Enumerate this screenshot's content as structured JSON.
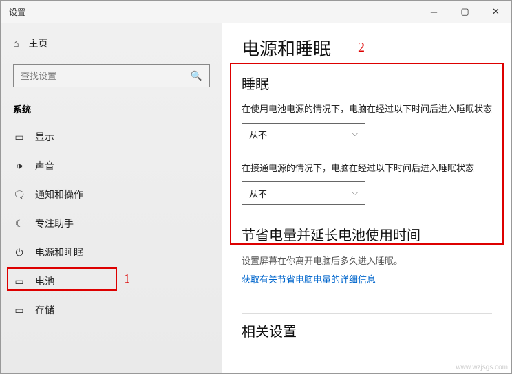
{
  "window": {
    "title": "设置"
  },
  "sidebar": {
    "home": "主页",
    "search_placeholder": "查找设置",
    "section": "系统",
    "items": [
      {
        "icon": "▭",
        "label": "显示"
      },
      {
        "icon": "🕩",
        "label": "声音"
      },
      {
        "icon": "🗨",
        "label": "通知和操作"
      },
      {
        "icon": "☾",
        "label": "专注助手"
      },
      {
        "icon": "⏻",
        "label": "电源和睡眠"
      },
      {
        "icon": "▭",
        "label": "电池"
      },
      {
        "icon": "▭",
        "label": "存储"
      }
    ]
  },
  "content": {
    "title": "电源和睡眠",
    "sleep_heading": "睡眠",
    "battery_desc": "在使用电池电源的情况下，电脑在经过以下时间后进入睡眠状态",
    "battery_value": "从不",
    "plugged_desc": "在接通电源的情况下，电脑在经过以下时间后进入睡眠状态",
    "plugged_value": "从不",
    "save_heading": "节省电量并延长电池使用时间",
    "save_sub": "设置屏幕在你离开电脑后多久进入睡眠。",
    "save_link": "获取有关节省电脑电量的详细信息",
    "related_heading": "相关设置"
  },
  "annotations": {
    "a1": "1",
    "a2": "2"
  },
  "watermark": "www.wzjsgs.com"
}
